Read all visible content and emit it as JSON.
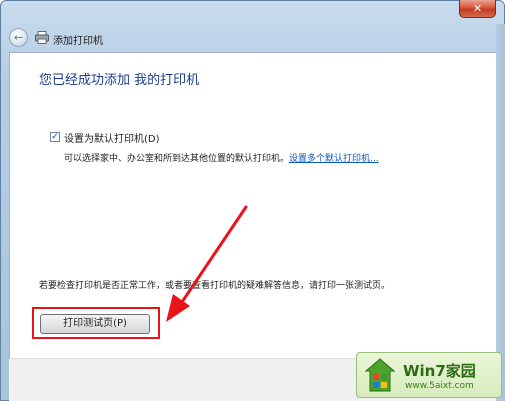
{
  "window": {
    "close_glyph": "✕"
  },
  "titlebar": {
    "back_icon": "back-arrow-icon",
    "title": "添加打印机"
  },
  "main": {
    "heading": "您已经成功添加 我的打印机",
    "default_printer": {
      "label": "设置为默认打印机(D)",
      "checked": true
    },
    "description": "可以选择家中、办公室和所到达其他位置的默认打印机。",
    "description_link": "设置多个默认打印机...",
    "test_hint": "若要检查打印机是否正常工作，或者要查看打印机的疑难解答信息，请打印一张测试页。",
    "print_test_button": "打印测试页(P)"
  },
  "annotation": {
    "color": "#e8141a"
  },
  "watermark": {
    "title": "Win7家园",
    "url": "www.5aixt.com"
  }
}
